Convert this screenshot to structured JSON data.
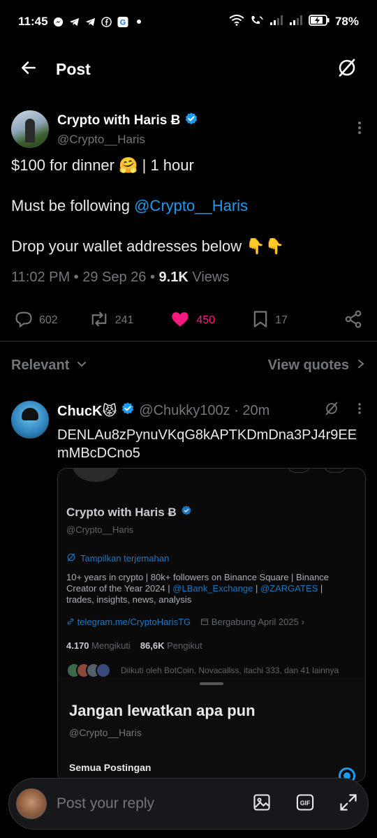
{
  "status": {
    "time": "11:45",
    "battery": "78%",
    "notification_icons": [
      "messenger-icon",
      "telegram-icon",
      "telegram-icon",
      "facebook-icon",
      "google-icon",
      "dot-icon"
    ]
  },
  "header": {
    "title": "Post"
  },
  "post": {
    "author_name": "Crypto with Haris Ƀ",
    "handle": "@Crypto__Haris",
    "line1": "$100 for dinner 🤗 | 1 hour",
    "line2_prefix": "Must be following ",
    "line2_mention": "@Crypto__Haris",
    "line3": "Drop your wallet addresses below 👇👇",
    "timestamp": "11:02 PM • 29 Sep 26 • ",
    "views_count": "9.1K",
    "views_label": " Views",
    "replies": "602",
    "reposts": "241",
    "likes": "450",
    "bookmarks": "17"
  },
  "sort": {
    "relevant": "Relevant",
    "view_quotes": "View quotes"
  },
  "reply": {
    "name": "ChucK😾",
    "handle_time": "@Chukky100z · 20m",
    "text": "DENLAu8zPynuVKqG8kAPTKDmDna3PJ4r9EEmMBcDCno5"
  },
  "embed": {
    "name": "Crypto with Haris Ƀ",
    "handle": "@Crypto__Haris",
    "translate": "Tampilkan terjemahan",
    "bio_1": "10+ years in crypto | 80k+ followers on Binance Square | Binance Creator of the Year 2024 | ",
    "bio_m1": "@LBank_Exchange",
    "bio_sep": " | ",
    "bio_m2": "@ZARGATES",
    "bio_2": " | trades, insights, news, analysis",
    "link": "telegram.me/CryptoHarisTG",
    "joined": "Bergabung April 2025",
    "following_count": "4.170",
    "following_label": "Mengikuti",
    "followers_count": "86,6K",
    "followers_label": "Pengikut",
    "followed_by": "Diikuti oleh BotCoin, Novacallss, itachi 333, dan 41 lainnya",
    "sheet_title": "Jangan lewatkan apa pun",
    "sheet_handle": "@Crypto__Haris",
    "sheet_option": "Semua Postingan"
  },
  "replybar": {
    "placeholder": "Post your reply",
    "gif": "GIF"
  },
  "colors": {
    "accent": "#1d9bf0",
    "like": "#f91880",
    "muted": "#71767b",
    "background": "#000000"
  }
}
